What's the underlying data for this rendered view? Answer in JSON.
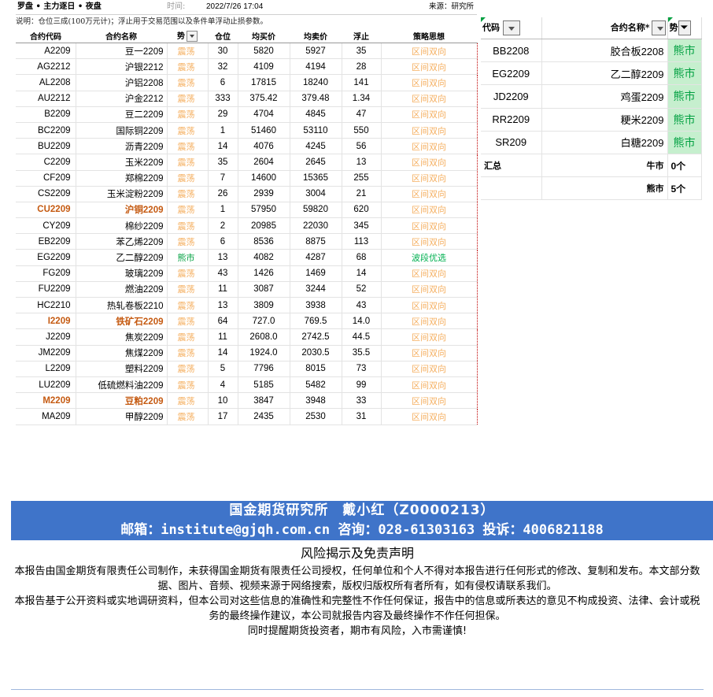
{
  "header": {
    "title": "罗盘 • 主力逐日 • 夜盘",
    "time_label": "时间:",
    "time_value": "2022/7/26 17:04",
    "source": "来源：研究所",
    "note": "说明：仓位三成(100万元计)；浮止用于交易范围以及条件单浮动止损参数。"
  },
  "table": {
    "columns": [
      "合约代码",
      "合约名称",
      "势",
      "仓位",
      "均买价",
      "均卖价",
      "浮止",
      "策略思想"
    ],
    "rows": [
      {
        "code": "A2209",
        "name": "豆一2209",
        "trend": "震荡",
        "pos": "30",
        "buy": "5820",
        "sell": "5927",
        "stop": "35",
        "strategy": "区间双向"
      },
      {
        "code": "AG2212",
        "name": "沪银2212",
        "trend": "震荡",
        "pos": "32",
        "buy": "4109",
        "sell": "4194",
        "stop": "28",
        "strategy": "区间双向"
      },
      {
        "code": "AL2208",
        "name": "沪铝2208",
        "trend": "震荡",
        "pos": "6",
        "buy": "17815",
        "sell": "18240",
        "stop": "141",
        "strategy": "区间双向"
      },
      {
        "code": "AU2212",
        "name": "沪金2212",
        "trend": "震荡",
        "pos": "333",
        "buy": "375.42",
        "sell": "379.48",
        "stop": "1.34",
        "strategy": "区间双向"
      },
      {
        "code": "B2209",
        "name": "豆二2209",
        "trend": "震荡",
        "pos": "29",
        "buy": "4704",
        "sell": "4845",
        "stop": "47",
        "strategy": "区间双向"
      },
      {
        "code": "BC2209",
        "name": "国际铜2209",
        "trend": "震荡",
        "pos": "1",
        "buy": "51460",
        "sell": "53110",
        "stop": "550",
        "strategy": "区间双向"
      },
      {
        "code": "BU2209",
        "name": "沥青2209",
        "trend": "震荡",
        "pos": "14",
        "buy": "4076",
        "sell": "4245",
        "stop": "56",
        "strategy": "区间双向"
      },
      {
        "code": "C2209",
        "name": "玉米2209",
        "trend": "震荡",
        "pos": "35",
        "buy": "2604",
        "sell": "2645",
        "stop": "13",
        "strategy": "区间双向"
      },
      {
        "code": "CF209",
        "name": "郑棉2209",
        "trend": "震荡",
        "pos": "7",
        "buy": "14600",
        "sell": "15365",
        "stop": "255",
        "strategy": "区间双向"
      },
      {
        "code": "CS2209",
        "name": "玉米淀粉2209",
        "trend": "震荡",
        "pos": "26",
        "buy": "2939",
        "sell": "3004",
        "stop": "21",
        "strategy": "区间双向"
      },
      {
        "code": "CU2209",
        "name": "沪铜2209",
        "trend": "震荡",
        "pos": "1",
        "buy": "57950",
        "sell": "59820",
        "stop": "620",
        "strategy": "区间双向",
        "highlight": true
      },
      {
        "code": "CY209",
        "name": "棉纱2209",
        "trend": "震荡",
        "pos": "2",
        "buy": "20985",
        "sell": "22030",
        "stop": "345",
        "strategy": "区间双向"
      },
      {
        "code": "EB2209",
        "name": "苯乙烯2209",
        "trend": "震荡",
        "pos": "6",
        "buy": "8536",
        "sell": "8875",
        "stop": "113",
        "strategy": "区间双向"
      },
      {
        "code": "EG2209",
        "name": "乙二醇2209",
        "trend": "熊市",
        "pos": "13",
        "buy": "4082",
        "sell": "4287",
        "stop": "68",
        "strategy": "波段优选",
        "bear": true
      },
      {
        "code": "FG209",
        "name": "玻璃2209",
        "trend": "震荡",
        "pos": "43",
        "buy": "1426",
        "sell": "1469",
        "stop": "14",
        "strategy": "区间双向"
      },
      {
        "code": "FU2209",
        "name": "燃油2209",
        "trend": "震荡",
        "pos": "11",
        "buy": "3087",
        "sell": "3244",
        "stop": "52",
        "strategy": "区间双向"
      },
      {
        "code": "HC2210",
        "name": "热轧卷板2210",
        "trend": "震荡",
        "pos": "13",
        "buy": "3809",
        "sell": "3938",
        "stop": "43",
        "strategy": "区间双向"
      },
      {
        "code": "I2209",
        "name": "铁矿石2209",
        "trend": "震荡",
        "pos": "64",
        "buy": "727.0",
        "sell": "769.5",
        "stop": "14.0",
        "strategy": "区间双向",
        "highlight": true
      },
      {
        "code": "J2209",
        "name": "焦炭2209",
        "trend": "震荡",
        "pos": "11",
        "buy": "2608.0",
        "sell": "2742.5",
        "stop": "44.5",
        "strategy": "区间双向"
      },
      {
        "code": "JM2209",
        "name": "焦煤2209",
        "trend": "震荡",
        "pos": "14",
        "buy": "1924.0",
        "sell": "2030.5",
        "stop": "35.5",
        "strategy": "区间双向"
      },
      {
        "code": "L2209",
        "name": "塑料2209",
        "trend": "震荡",
        "pos": "5",
        "buy": "7796",
        "sell": "8015",
        "stop": "73",
        "strategy": "区间双向"
      },
      {
        "code": "LU2209",
        "name": "低硫燃料油2209",
        "trend": "震荡",
        "pos": "4",
        "buy": "5185",
        "sell": "5482",
        "stop": "99",
        "strategy": "区间双向"
      },
      {
        "code": "M2209",
        "name": "豆粕2209",
        "trend": "震荡",
        "pos": "10",
        "buy": "3847",
        "sell": "3948",
        "stop": "33",
        "strategy": "区间双向",
        "highlight": true
      },
      {
        "code": "MA209",
        "name": "甲醇2209",
        "trend": "震荡",
        "pos": "17",
        "buy": "2435",
        "sell": "2530",
        "stop": "31",
        "strategy": "区间双向"
      }
    ]
  },
  "side": {
    "columns": [
      "代码",
      "合约名称*",
      "势"
    ],
    "rows": [
      {
        "code": "BB2208",
        "name": "胶合板2208",
        "trend": "熊市"
      },
      {
        "code": "EG2209",
        "name": "乙二醇2209",
        "trend": "熊市"
      },
      {
        "code": "JD2209",
        "name": "鸡蛋2209",
        "trend": "熊市"
      },
      {
        "code": "RR2209",
        "name": "粳米2209",
        "trend": "熊市"
      },
      {
        "code": "SR209",
        "name": "白糖2209",
        "trend": "熊市"
      }
    ],
    "summary_label": "汇总",
    "summary": [
      {
        "name": "牛市",
        "count": "0个"
      },
      {
        "name": "熊市",
        "count": "5个"
      }
    ]
  },
  "banner": {
    "line1": "国金期货研究所　戴小红（Z0000213）",
    "line2": "邮箱：institute@gjqh.com.cn 咨询：028-61303163 投诉：4006821188"
  },
  "disclaimer": {
    "title": "风险揭示及免责声明",
    "paragraphs": [
      "本报告由国金期货有限责任公司制作，未获得国金期货有限责任公司授权，任何单位和个人不得对本报告进行任何形式的修改、复制和发布。本文部分数据、图片、音频、视频来源于网络搜索，版权归版权所有者所有，如有侵权请联系我们。",
      "本报告基于公开资料或实地调研资料，但本公司对这些信息的准确性和完整性不作任何保证，报告中的信息或所表达的意见不构成投资、法律、会计或税务的最终操作建议，本公司就报告内容及最终操作不作任何担保。",
      "同时提醒期货投资者，期市有风险，入市需谨慎!"
    ]
  },
  "colors": {
    "range_text": "#f5b062",
    "bear_text": "#00a040",
    "bear_fill": "#c6efce",
    "highlight_text": "#c55a11",
    "banner_bg": "#3f74c9"
  }
}
